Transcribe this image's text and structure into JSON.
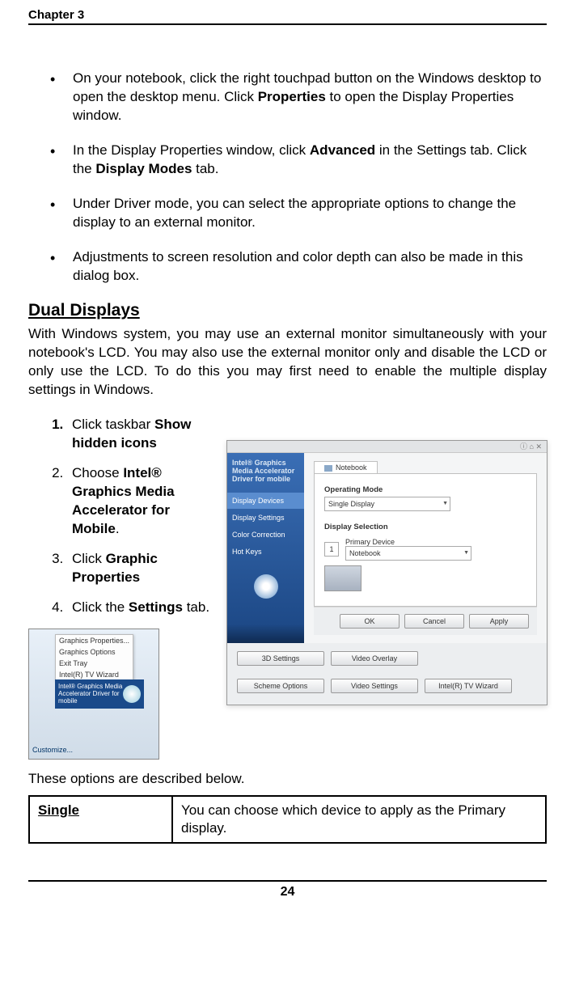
{
  "chapter_header": "Chapter 3",
  "page_number": "24",
  "bullets": [
    {
      "pre": "On your notebook, click the right touchpad button on the Windows desktop to open the desktop menu. Click ",
      "b1": "Properties",
      "post": " to open the Display Properties window."
    },
    {
      "pre": "In the Display Properties window, click ",
      "b1": "Advanced",
      "mid": " in the Settings tab. Click the ",
      "b2": "Display Modes",
      "post": " tab."
    },
    {
      "pre": "Under Driver mode, you can select the appropriate options to change the display to an external monitor."
    },
    {
      "pre": "Adjustments to screen resolution and color depth can also be made in this dialog box."
    }
  ],
  "dual_heading": "Dual Displays",
  "dual_para": "With Windows system, you may use an external monitor simultaneously with your notebook's LCD. You may also use the external monitor only and disable the LCD or only use the LCD. To do this you may first need to enable the multiple display settings in Windows.",
  "steps": {
    "s1_pre": "Click taskbar ",
    "s1_b": "Show hidden icons",
    "s2_pre": "Choose ",
    "s2_b": "Intel® Graphics Media Accelerator for Mobile",
    "s2_post": ".",
    "s3_pre": "Click ",
    "s3_b": "Graphic Properties",
    "s4_pre": "Click the ",
    "s4_b": "Settings",
    "s4_post": " tab."
  },
  "context_menu": {
    "i1": "Graphics Properties...",
    "i2": "Graphics Options",
    "i3": "Exit Tray",
    "i4": "Intel(R) TV Wizard",
    "driver": "Intel® Graphics Media Accelerator Driver for mobile",
    "customize": "Customize..."
  },
  "intel_panel": {
    "logo": "Intel® Graphics Media Accelerator Driver for mobile",
    "side": {
      "devices": "Display Devices",
      "settings": "Display Settings",
      "color": "Color Correction",
      "hotkeys": "Hot Keys"
    },
    "tab": "Notebook",
    "op_mode_label": "Operating Mode",
    "op_mode_value": "Single Display",
    "disp_sel_label": "Display Selection",
    "primary_label": "Primary Device",
    "primary_value": "Notebook",
    "num": "1",
    "btns": {
      "ok": "OK",
      "cancel": "Cancel",
      "apply": "Apply"
    },
    "bottom": {
      "b1": "3D Settings",
      "b2": "Video Overlay",
      "b3": "Scheme Options",
      "b4": "Video Settings",
      "b5": "Intel(R) TV Wizard"
    },
    "top_icons": "ⓘ ⌂ ✕"
  },
  "options_caption": "These options are described below.",
  "opt_table": {
    "left": "Single",
    "right": "You can choose which device to apply as the Primary display."
  }
}
